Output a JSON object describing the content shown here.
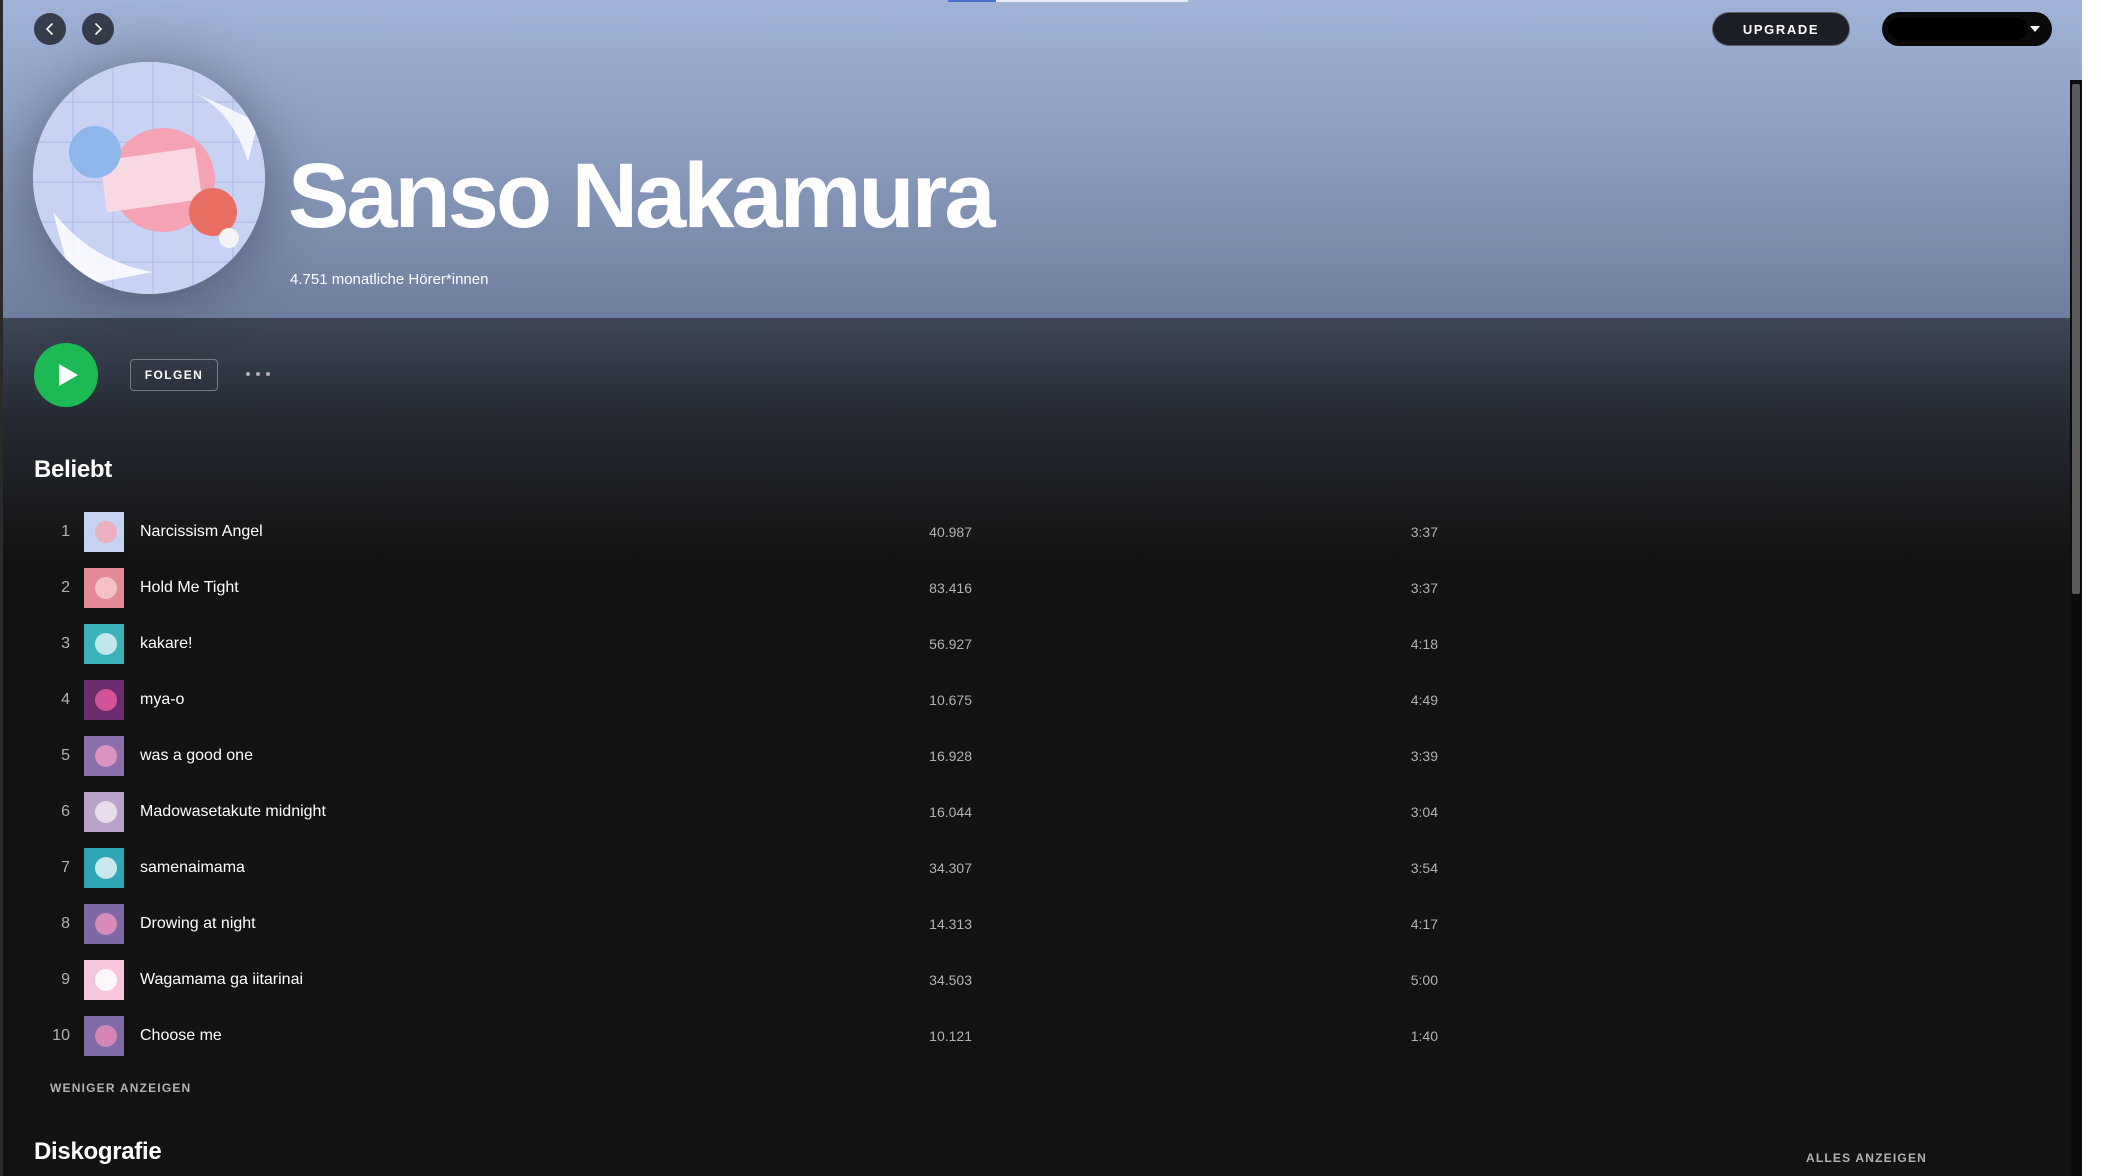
{
  "topbar": {
    "back_icon": "chevron-left-icon",
    "forward_icon": "chevron-right-icon",
    "upgrade_label": "UPGRADE",
    "user_menu_icon": "caret-down-icon",
    "loading_progress": 0.2
  },
  "artist": {
    "name": "Sanso Nakamura",
    "monthly_listeners": "4.751 monatliche Hörer*innen",
    "image_icon": "artist-avatar"
  },
  "actions": {
    "play_icon": "play-icon",
    "follow_label": "FOLGEN",
    "more_icon": "more-dots-icon"
  },
  "popular": {
    "title": "Beliebt",
    "show_less_label": "WENIGER ANZEIGEN",
    "tracks": [
      {
        "num": "1",
        "title": "Narcissism Angel",
        "plays": "40.987",
        "duration": "3:37"
      },
      {
        "num": "2",
        "title": "Hold Me Tight",
        "plays": "83.416",
        "duration": "3:37"
      },
      {
        "num": "3",
        "title": "kakare!",
        "plays": "56.927",
        "duration": "4:18"
      },
      {
        "num": "4",
        "title": "mya-o",
        "plays": "10.675",
        "duration": "4:49"
      },
      {
        "num": "5",
        "title": "was a good one",
        "plays": "16.928",
        "duration": "3:39"
      },
      {
        "num": "6",
        "title": "Madowasetakute midnight",
        "plays": "16.044",
        "duration": "3:04"
      },
      {
        "num": "7",
        "title": "samenaimama",
        "plays": "34.307",
        "duration": "3:54"
      },
      {
        "num": "8",
        "title": "Drowing at night",
        "plays": "14.313",
        "duration": "4:17"
      },
      {
        "num": "9",
        "title": "Wagamama ga iitarinai",
        "plays": "34.503",
        "duration": "5:00"
      },
      {
        "num": "10",
        "title": "Choose me",
        "plays": "10.121",
        "duration": "1:40"
      }
    ]
  },
  "discography": {
    "title": "Diskografie",
    "show_all_label": "ALLES ANZEIGEN"
  },
  "colors": {
    "accent_green": "#1db954",
    "background": "#121212",
    "header_gradient_top": "#a0b3d8",
    "secondary_text": "#b3b3b3"
  }
}
